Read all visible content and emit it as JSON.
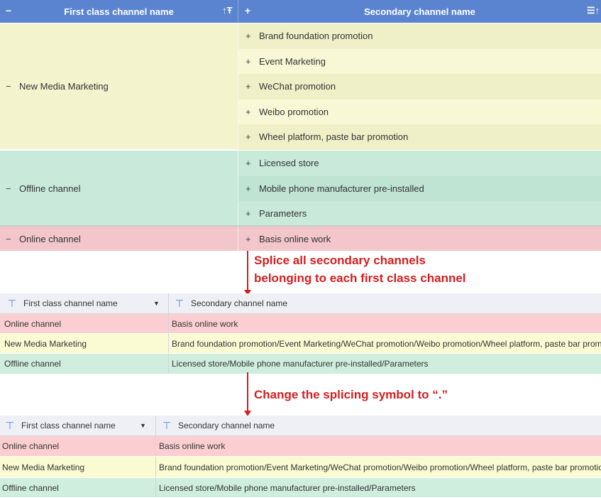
{
  "grouped_table": {
    "header": {
      "first_col": "First class channel name",
      "second_col": "Secondary channel name",
      "collapse_icon": "minus-icon",
      "expand_icon": "plus-icon",
      "sort_icon": "sort-icon"
    },
    "groups": [
      {
        "name": "New Media Marketing",
        "color": "#f3f3cd",
        "items": [
          "Brand foundation promotion",
          "Event Marketing",
          "WeChat promotion",
          "Weibo promotion",
          "Wheel platform, paste bar promotion"
        ]
      },
      {
        "name": "Offline channel",
        "color": "#c9eadb",
        "items": [
          "Licensed store",
          "Mobile phone manufacturer pre-installed",
          "Parameters"
        ]
      },
      {
        "name": "Online channel",
        "color": "#f2c6cb",
        "items": [
          "Basis online work"
        ]
      }
    ]
  },
  "annotations": {
    "first_line1": "Splice all secondary channels",
    "first_line2": "belonging to each first class channel",
    "second": "Change the splicing symbol to “.”",
    "color": "#d41e1e"
  },
  "table1": {
    "header": {
      "first_col": "First class channel name",
      "second_col": "Secondary channel name"
    },
    "rows": [
      {
        "first": "Online channel",
        "second": "Basis online work",
        "color": "#fbcfd2"
      },
      {
        "first": "New Media Marketing",
        "second": "Brand foundation promotion/Event Marketing/WeChat promotion/Weibo promotion/Wheel platform, paste bar promotion",
        "color": "#fbfbd3"
      },
      {
        "first": "Offline channel",
        "second": "Licensed store/Mobile phone manufacturer pre-installed/Parameters",
        "color": "#cfeedd"
      }
    ]
  },
  "table2": {
    "header": {
      "first_col": "First class channel name",
      "second_col": "Secondary channel name"
    },
    "rows": [
      {
        "first": "Online channel",
        "second": "Basis online work",
        "color": "#fbcfd2"
      },
      {
        "first": "New Media Marketing",
        "second": "Brand foundation promotion/Event Marketing/WeChat promotion/Weibo promotion/Wheel platform, paste bar promotion",
        "color": "#fbfbd3"
      },
      {
        "first": "Offline channel",
        "second": "Licensed store/Mobile phone manufacturer pre-installed/Parameters",
        "color": "#cfeedd"
      }
    ]
  }
}
